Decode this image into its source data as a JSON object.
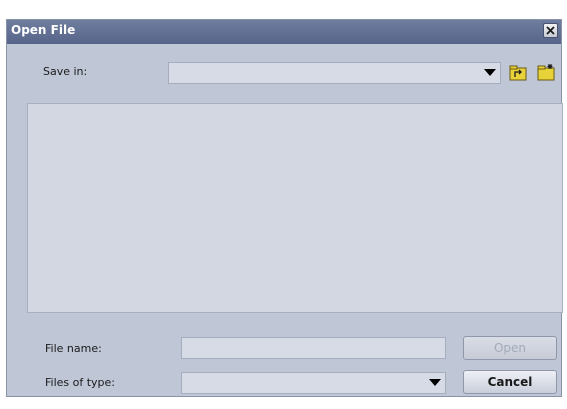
{
  "window": {
    "title": "Open File"
  },
  "save_in": {
    "label": "Save in:",
    "value": ""
  },
  "toolbar": {
    "icons": [
      "up-folder-icon",
      "new-folder-icon"
    ]
  },
  "file_name": {
    "label": "File name:",
    "value": ""
  },
  "files_of_type": {
    "label": "Files of type:",
    "value": ""
  },
  "buttons": {
    "open": "Open",
    "cancel": "Cancel"
  },
  "colors": {
    "titlebar": "#5f6d92",
    "dialog_bg": "#bfc6d6",
    "folder_icon": "#e8d23a"
  }
}
